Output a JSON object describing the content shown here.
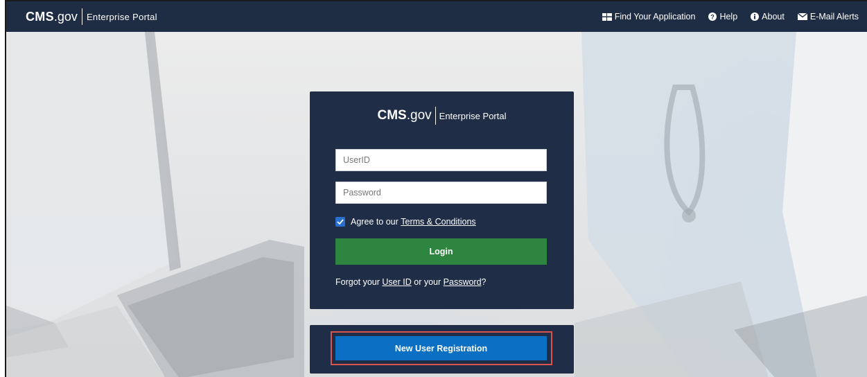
{
  "header": {
    "brand_cms": "CMS",
    "brand_gov": ".gov",
    "brand_portal": "Enterprise Portal",
    "nav": [
      {
        "label": "Find Your Application",
        "icon": "grid-icon"
      },
      {
        "label": "Help",
        "icon": "question-circle-icon"
      },
      {
        "label": "About",
        "icon": "info-circle-icon"
      },
      {
        "label": "E-Mail Alerts",
        "icon": "envelope-icon"
      }
    ]
  },
  "login": {
    "brand_cms": "CMS",
    "brand_gov": ".gov",
    "brand_portal": "Enterprise Portal",
    "userid_placeholder": "UserID",
    "password_placeholder": "Password",
    "agree_prefix": "Agree to our",
    "terms_link": "Terms & Conditions",
    "agree_checked": true,
    "login_label": "Login",
    "forgot_prefix": "Forgot your",
    "forgot_userid_link": "User ID",
    "forgot_middle": "or your",
    "forgot_password_link": "Password",
    "forgot_suffix": "?"
  },
  "registration": {
    "button_label": "New User Registration"
  },
  "colors": {
    "navbar": "#1f2d44",
    "panel": "#1f2d47",
    "login_button": "#2e8540",
    "registration_button": "#0b6fc4",
    "highlight_border": "#d9534f",
    "checkbox": "#2a6fcf"
  }
}
